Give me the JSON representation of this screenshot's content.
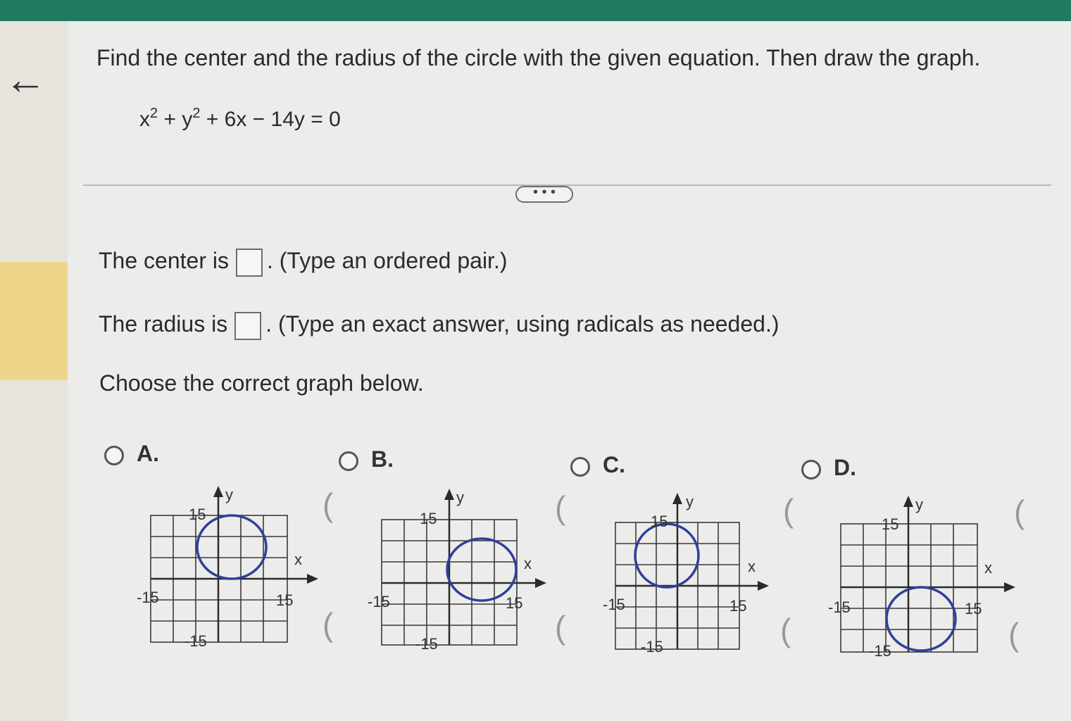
{
  "nav": {
    "back_icon": "←"
  },
  "question": {
    "prompt": "Find the center and the radius of the circle with the given equation. Then draw the graph.",
    "equation_parts": {
      "a": "x",
      "a_exp": "2",
      "op1": " + y",
      "b_exp": "2",
      "rest": " + 6x − 14y = 0"
    }
  },
  "more_button": "• • •",
  "center": {
    "prefix": "The center is",
    "suffix": ". (Type an ordered pair.)"
  },
  "radius": {
    "prefix": "The radius is",
    "suffix": ". (Type an exact answer, using radicals as needed.)"
  },
  "choose_label": "Choose the correct graph below.",
  "options": [
    {
      "label": "A.",
      "graph": {
        "ytick": "15",
        "xneg": "-15",
        "xpos": "15",
        "yneg": "-15",
        "xaxis": "x",
        "yaxis": "y"
      }
    },
    {
      "label": "B.",
      "graph": {
        "ytick": "15",
        "xneg": "-15",
        "xpos": "15",
        "yneg": "-15",
        "xaxis": "x",
        "yaxis": "y"
      }
    },
    {
      "label": "C.",
      "graph": {
        "ytick": "15",
        "xneg": "-15",
        "xpos": "15",
        "yneg": "-15",
        "xaxis": "x",
        "yaxis": "y"
      }
    },
    {
      "label": "D.",
      "graph": {
        "ytick": "15",
        "xneg": "-15",
        "xpos": "15",
        "yneg": "-15",
        "xaxis": "x",
        "yaxis": "y"
      }
    }
  ],
  "colors": {
    "circle": "#2f3f9c",
    "grid": "#3a3a3a",
    "accent": "#1f7a61"
  }
}
